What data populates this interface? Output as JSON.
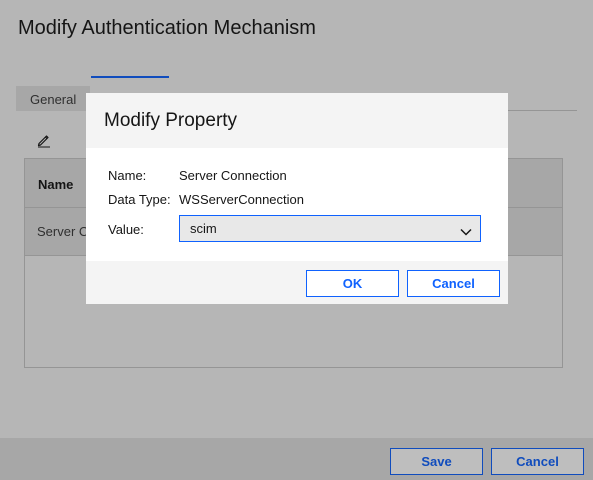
{
  "background_dialog": {
    "title": "Modify Authentication Mechanism",
    "tabs": [
      {
        "label": "General"
      },
      {
        "label": ""
      }
    ],
    "table": {
      "header_name": "Name",
      "rows": [
        {
          "name": "Server C"
        }
      ]
    },
    "footer": {
      "save_label": "Save",
      "cancel_label": "Cancel"
    }
  },
  "modal": {
    "title": "Modify Property",
    "name_label": "Name:",
    "name_value": "Server Connection",
    "data_type_label": "Data Type:",
    "data_type_value": "WSServerConnection",
    "value_label": "Value:",
    "value_selected": "scim",
    "ok_label": "OK",
    "cancel_label": "Cancel"
  },
  "colors": {
    "accent": "#0f62fe",
    "header_bg": "#f4f4f4",
    "overlay": "#b9b9b9"
  }
}
